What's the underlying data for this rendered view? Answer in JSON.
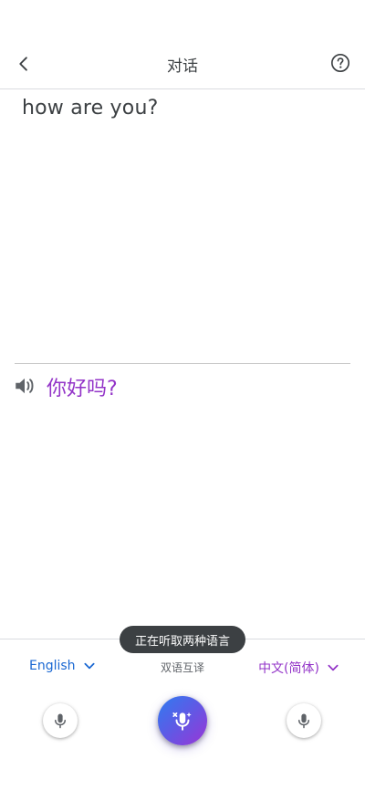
{
  "header": {
    "title": "对话",
    "back_icon": "chevron-left-icon",
    "help_icon": "help-circle-icon"
  },
  "conversation": {
    "source_text": "how are you?",
    "translated_text": "你好吗?",
    "speaker_icon": "volume-icon"
  },
  "toast": {
    "message": "正在听取两种语言"
  },
  "controls": {
    "left_language": "English",
    "right_language": "中文(简体)",
    "mode_label": "双语互译",
    "left_mic_icon": "microphone-icon",
    "center_mic_icon": "auto-microphone-icon",
    "right_mic_icon": "microphone-icon"
  },
  "colors": {
    "left_language": "#1967d2",
    "right_language": "#9334c8",
    "toast_background": "#3c4043"
  }
}
